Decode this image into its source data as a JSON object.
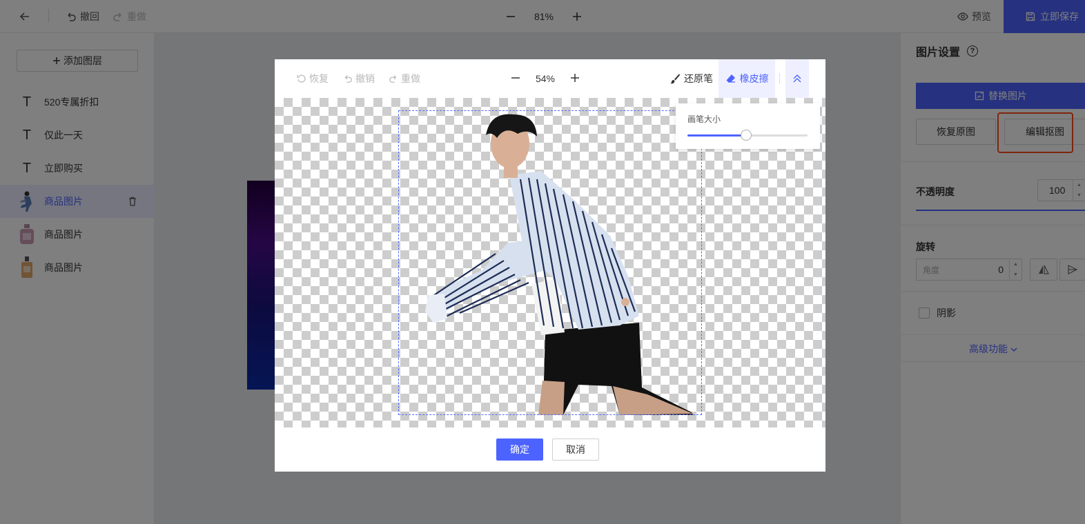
{
  "topbar": {
    "back_icon": "arrow-left-icon",
    "undo_label": "撤回",
    "redo_label": "重做",
    "zoom": "81%",
    "preview_label": "预览",
    "save_label": "立即保存"
  },
  "sidebar": {
    "add_layer_label": "添加图层",
    "layers": [
      {
        "type": "text",
        "label": "520专属折扣"
      },
      {
        "type": "text",
        "label": "仅此一天"
      },
      {
        "type": "text",
        "label": "立即购买"
      },
      {
        "type": "image",
        "label": "商品图片",
        "selected": true
      },
      {
        "type": "image",
        "label": "商品图片"
      },
      {
        "type": "image",
        "label": "商品图片"
      }
    ]
  },
  "right_panel": {
    "title": "图片设置",
    "replace_label": "替换图片",
    "restore_label": "恢复原图",
    "edit_cutout_label": "编辑抠图",
    "opacity_label": "不透明度",
    "opacity_value": "100",
    "rotate_label": "旋转",
    "angle_placeholder": "角度",
    "angle_value": "0",
    "shadow_label": "阴影",
    "advanced_label": "高级功能"
  },
  "dialog": {
    "restore_label": "恢复",
    "undo_label": "撤销",
    "redo_label": "重做",
    "zoom": "54%",
    "brush_restore_label": "还原笔",
    "eraser_label": "橡皮擦",
    "brush_size_label": "画笔大小",
    "brush_size_fraction": 0.49,
    "ok_label": "确定",
    "cancel_label": "取消"
  },
  "colors": {
    "accent": "#4d63ff",
    "highlight": "#ff4a1c",
    "overlay": "rgba(0,0,0,0.5)"
  }
}
